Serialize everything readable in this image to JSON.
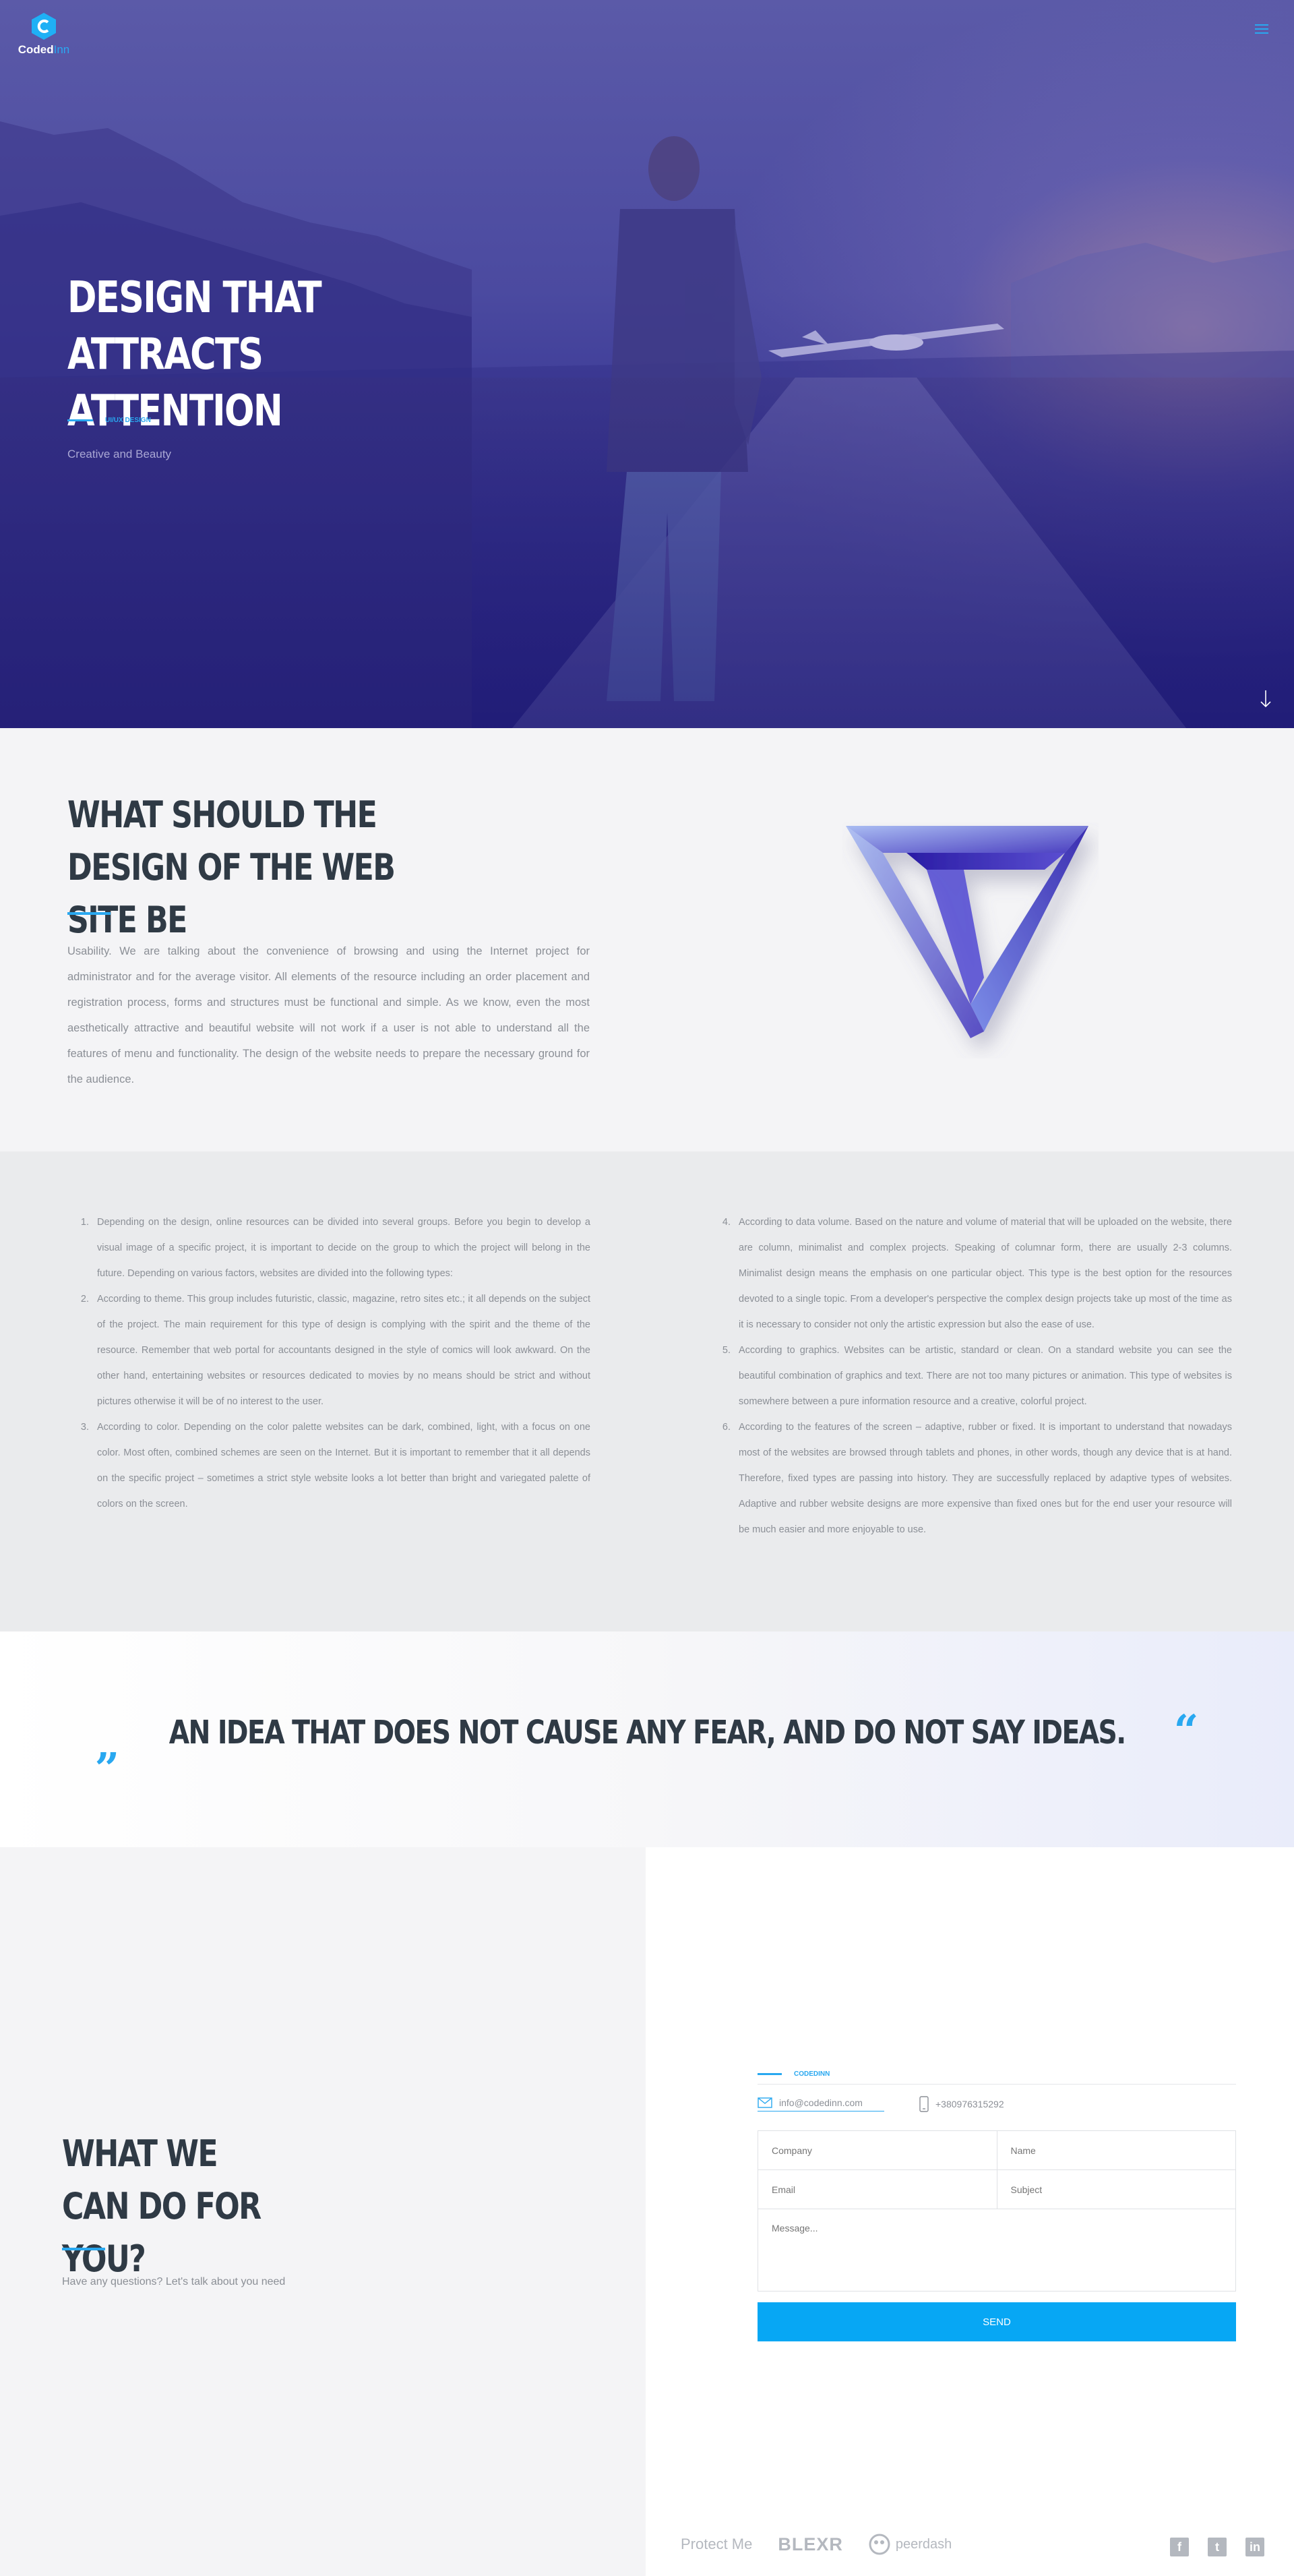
{
  "header": {
    "logo_main": "Coded",
    "logo_accent": "Inn",
    "logo_letter": "C",
    "menu_icon": "hamburger-menu-icon"
  },
  "hero": {
    "title": "DESIGN THAT ATTRACTS ATTENTION",
    "tag": "UI/UX DESIGN",
    "subtitle": "Creative and Beauty",
    "scroll_icon": "arrow-down-icon"
  },
  "about": {
    "title": "WHAT SHOULD THE DESIGN OF THE WEB SITE BE",
    "text": "Usability. We are talking about the convenience of browsing and using the Internet project for administrator and for the average visitor. All elements of the resource including an order placement and registration process, forms and structures must be functional and simple. As we know, even the most aesthetically attractive and beautiful website will not work if a user is not able to understand all the features of menu and functionality. The design of the website needs to prepare the necessary ground for the audience."
  },
  "list": {
    "left": [
      "Depending on the design, online resources can be divided into several groups. Before you begin to develop a visual image of a specific project, it is important to decide on the group to which the project will belong in the future. Depending on various factors, websites are divided into the following types:",
      "According to theme. This group includes futuristic, classic, magazine, retro sites etc.; it all depends on the subject of the project. The main requirement for this type of design is complying with the spirit and the theme of the resource. Remember that web portal for accountants designed in the style of comics will look awkward. On the other hand, entertaining websites or resources dedicated to movies by no means should be strict and without pictures otherwise it will be of no interest to the user.",
      "According to color. Depending on the color palette websites can be dark, combined, light, with a focus on one color. Most often, combined schemes are seen on the Internet. But it is important to remember that it all depends on the specific project – sometimes a strict style website looks a lot better than bright and variegated palette of colors on the screen."
    ],
    "right": [
      "According to data volume. Based on the nature and volume of material that will be uploaded on the website, there are column, minimalist and complex projects. Speaking of columnar form, there are usually 2-3 columns. Minimalist design means the emphasis on one particular object. This type is the best option for the resources devoted to a single topic. From a developer's perspective the complex design projects take up most of the time as it is necessary to consider not only the artistic expression but also the ease of use.",
      "According to graphics. Websites can be artistic, standard or clean. On a standard website you can see the beautiful combination of graphics and text. There are not too many pictures or animation. This type of websites is somewhere between a pure information resource and a creative, colorful project.",
      "According to the features of the screen – adaptive, rubber or fixed. It is important to understand that nowadays most of the websites are browsed through tablets and phones, in other words, though any device that is at hand. Therefore, fixed types are passing into history. They are successfully replaced by adaptive types of websites. Adaptive and rubber website designs are more expensive than fixed ones but for the end user your resource will be much easier and more enjoyable to use."
    ]
  },
  "quote": {
    "open": "„",
    "text": "AN IDEA THAT DOES NOT CAUSE ANY FEAR, AND DO NOT SAY IDEAS.",
    "close": "“"
  },
  "contact": {
    "title": "WHAT WE CAN DO FOR YOU?",
    "subtitle": "Have any questions? Let's talk about you need",
    "form_tag": "CODEDINN",
    "email": "info@codedinn.com",
    "phone": "+380976315292",
    "placeholders": {
      "company": "Company",
      "name": "Name",
      "email": "Email",
      "subject": "Subject",
      "message": "Message..."
    },
    "send_label": "SEND"
  },
  "footer": {
    "partners": [
      "Protect Me",
      "BLEXR",
      "peerdash"
    ],
    "socials": [
      "facebook-icon",
      "twitter-icon",
      "linkedin-icon"
    ]
  },
  "colors": {
    "accent": "#29a8f0",
    "dark": "#2f3a45",
    "hero": "#3b3a9a"
  }
}
